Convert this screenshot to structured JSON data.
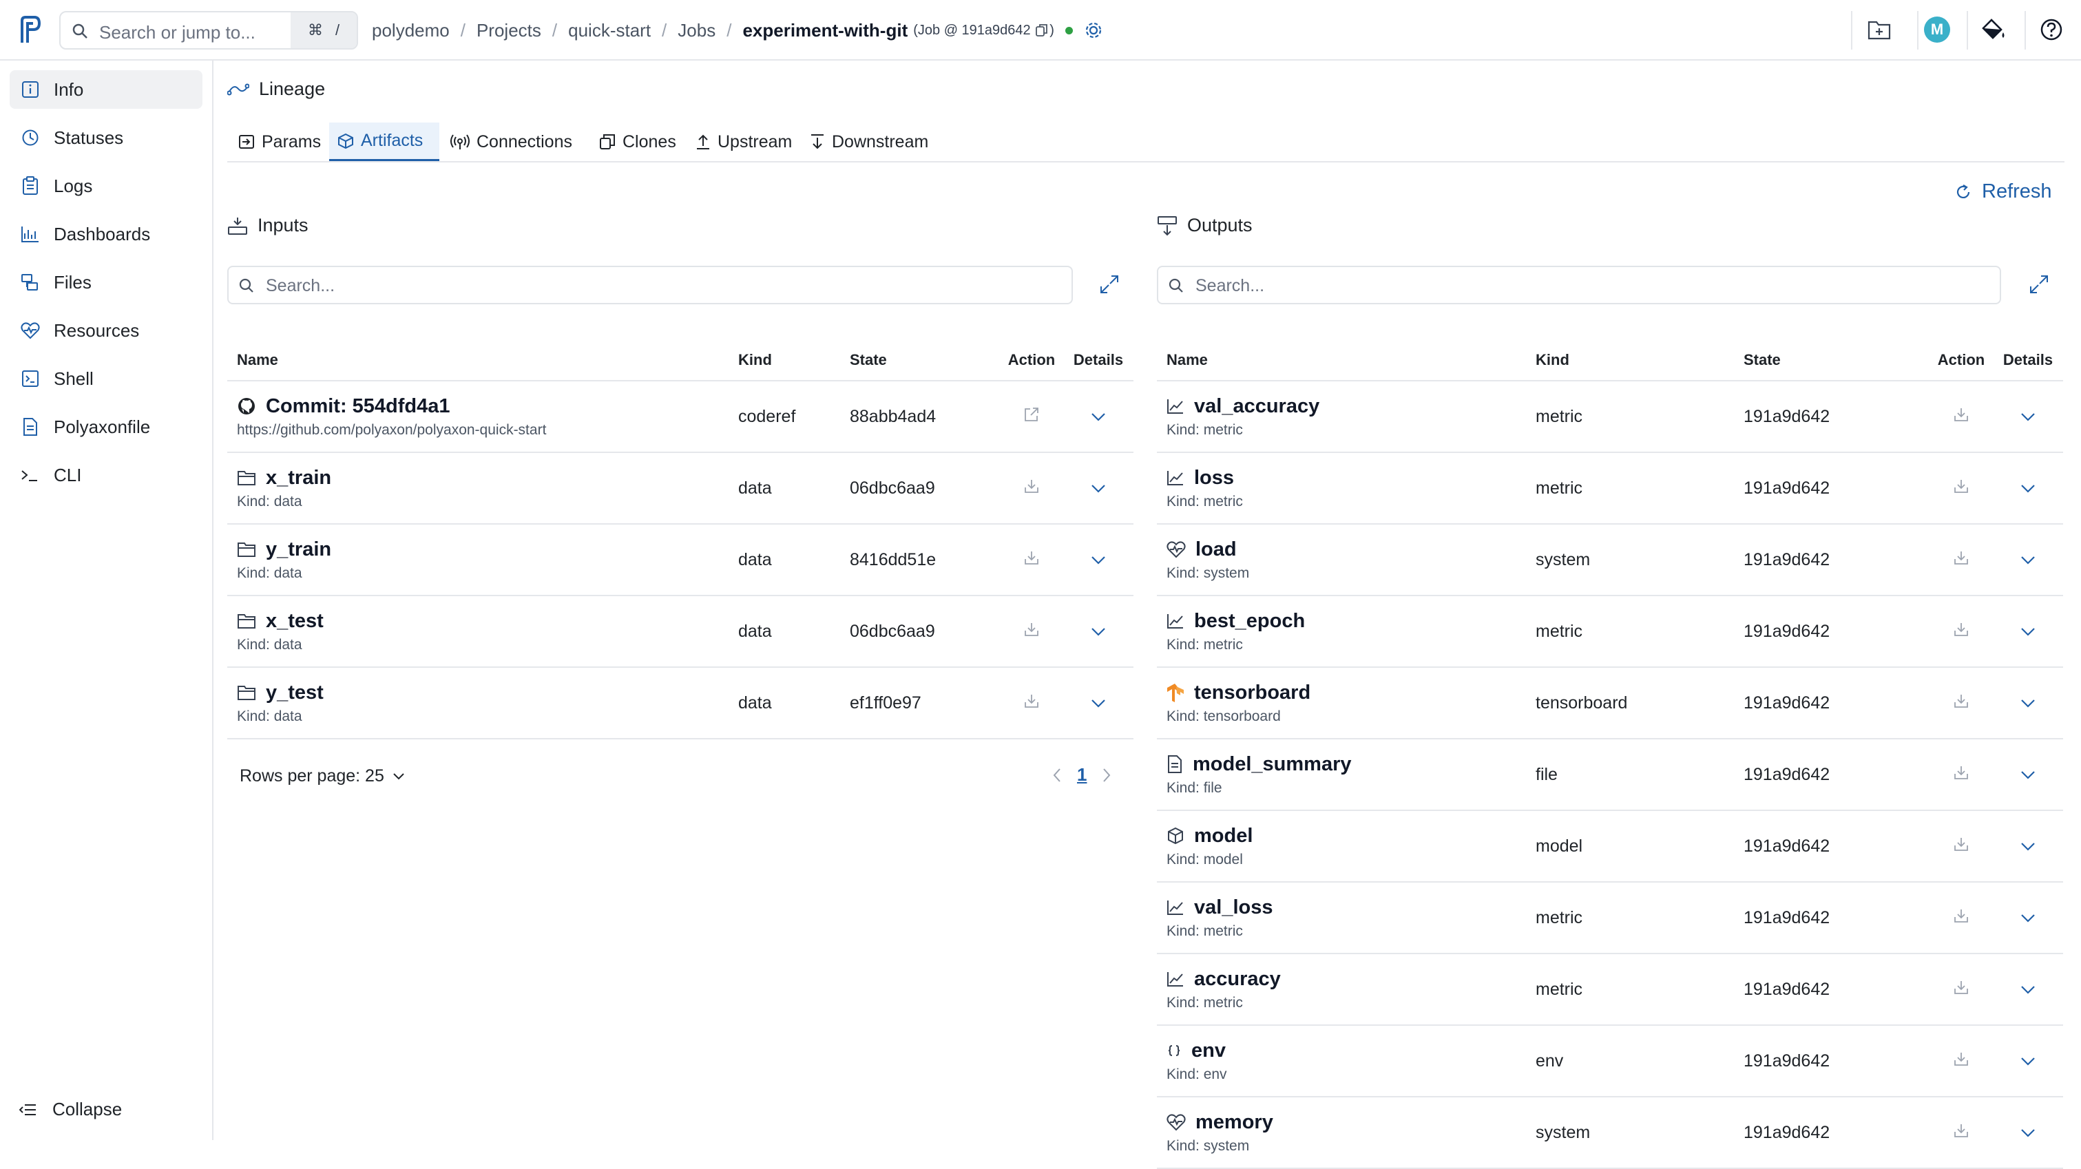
{
  "topbar": {
    "search_placeholder": "Search or jump to...",
    "shortcut_cmd": "⌘",
    "shortcut_slash": "/",
    "breadcrumbs": [
      "polydemo",
      "Projects",
      "quick-start",
      "Jobs"
    ],
    "current": "experiment-with-git",
    "current_meta_open": "(Job @ 191a9d642",
    "current_meta_close": ")",
    "avatar_letter": "M",
    "status_color": "#2ea043"
  },
  "sidebar": {
    "items": [
      {
        "label": "Info",
        "icon": "info-icon"
      },
      {
        "label": "Statuses",
        "icon": "clock-icon"
      },
      {
        "label": "Logs",
        "icon": "clipboard-icon"
      },
      {
        "label": "Dashboards",
        "icon": "chart-icon"
      },
      {
        "label": "Files",
        "icon": "files-icon"
      },
      {
        "label": "Resources",
        "icon": "heartbeat-icon"
      },
      {
        "label": "Shell",
        "icon": "terminal-box-icon"
      },
      {
        "label": "Polyaxonfile",
        "icon": "document-icon"
      },
      {
        "label": "CLI",
        "icon": "prompt-icon"
      }
    ],
    "collapse_label": "Collapse"
  },
  "main": {
    "lineage_title": "Lineage",
    "tabs": [
      "Params",
      "Artifacts",
      "Connections",
      "Clones",
      "Upstream",
      "Downstream"
    ],
    "active_tab": "Artifacts",
    "refresh_label": "Refresh"
  },
  "inputs": {
    "title": "Inputs",
    "search_placeholder": "Search...",
    "columns": [
      "Name",
      "Kind",
      "State",
      "Action",
      "Details"
    ],
    "rows": [
      {
        "name": "Commit: 554dfd4a1",
        "sub": "https://github.com/polyaxon/polyaxon-quick-start",
        "kind": "coderef",
        "state": "88abb4ad4",
        "icon": "github-icon",
        "action": "external-link-icon"
      },
      {
        "name": "x_train",
        "sub": "Kind: data",
        "kind": "data",
        "state": "06dbc6aa9",
        "icon": "folder-icon",
        "action": "download-icon"
      },
      {
        "name": "y_train",
        "sub": "Kind: data",
        "kind": "data",
        "state": "8416dd51e",
        "icon": "folder-icon",
        "action": "download-icon"
      },
      {
        "name": "x_test",
        "sub": "Kind: data",
        "kind": "data",
        "state": "06dbc6aa9",
        "icon": "folder-icon",
        "action": "download-icon"
      },
      {
        "name": "y_test",
        "sub": "Kind: data",
        "kind": "data",
        "state": "ef1ff0e97",
        "icon": "folder-icon",
        "action": "download-icon"
      }
    ],
    "rows_per_page_label": "Rows per page: 25",
    "page": "1"
  },
  "outputs": {
    "title": "Outputs",
    "search_placeholder": "Search...",
    "columns": [
      "Name",
      "Kind",
      "State",
      "Action",
      "Details"
    ],
    "rows": [
      {
        "name": "val_accuracy",
        "sub": "Kind: metric",
        "kind": "metric",
        "state": "191a9d642",
        "icon": "line-chart-icon"
      },
      {
        "name": "loss",
        "sub": "Kind: metric",
        "kind": "metric",
        "state": "191a9d642",
        "icon": "line-chart-icon"
      },
      {
        "name": "load",
        "sub": "Kind: system",
        "kind": "system",
        "state": "191a9d642",
        "icon": "heartbeat-icon"
      },
      {
        "name": "best_epoch",
        "sub": "Kind: metric",
        "kind": "metric",
        "state": "191a9d642",
        "icon": "line-chart-icon"
      },
      {
        "name": "tensorboard",
        "sub": "Kind: tensorboard",
        "kind": "tensorboard",
        "state": "191a9d642",
        "icon": "tensorflow-icon"
      },
      {
        "name": "model_summary",
        "sub": "Kind: file",
        "kind": "file",
        "state": "191a9d642",
        "icon": "file-icon"
      },
      {
        "name": "model",
        "sub": "Kind: model",
        "kind": "model",
        "state": "191a9d642",
        "icon": "cube-icon"
      },
      {
        "name": "val_loss",
        "sub": "Kind: metric",
        "kind": "metric",
        "state": "191a9d642",
        "icon": "line-chart-icon"
      },
      {
        "name": "accuracy",
        "sub": "Kind: metric",
        "kind": "metric",
        "state": "191a9d642",
        "icon": "line-chart-icon"
      },
      {
        "name": "env",
        "sub": "Kind: env",
        "kind": "env",
        "state": "191a9d642",
        "icon": "braces-icon"
      },
      {
        "name": "memory",
        "sub": "Kind: system",
        "kind": "system",
        "state": "191a9d642",
        "icon": "heartbeat-icon"
      }
    ]
  },
  "colors": {
    "accent": "#1f5fa8",
    "tensorflow": "#f08a24"
  }
}
